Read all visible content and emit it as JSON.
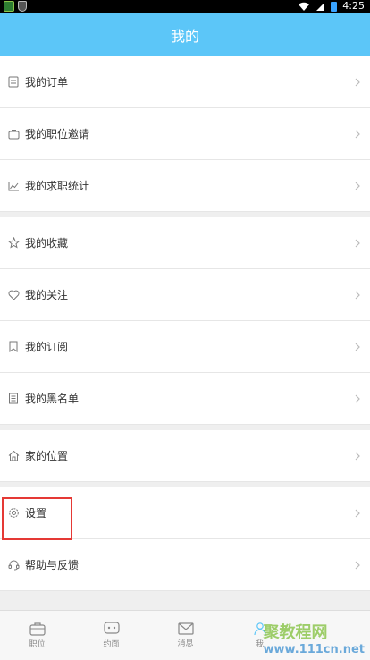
{
  "status_bar": {
    "time": "4:25"
  },
  "header": {
    "title": "我的"
  },
  "menu": {
    "orders": "我的订单",
    "invites": "我的职位邀请",
    "stats": "我的求职统计",
    "favorites": "我的收藏",
    "follows": "我的关注",
    "subscriptions": "我的订阅",
    "blacklist": "我的黑名单",
    "home_location": "家的位置",
    "settings": "设置",
    "help": "帮助与反馈"
  },
  "bottom_nav": {
    "jobs": "职位",
    "interview": "约面",
    "messages": "消息",
    "me": "我"
  },
  "watermark": {
    "brand": "聚教程网",
    "url": "www.111cn.net"
  },
  "colors": {
    "header": "#5cc6f8",
    "highlight": "#e53935"
  }
}
